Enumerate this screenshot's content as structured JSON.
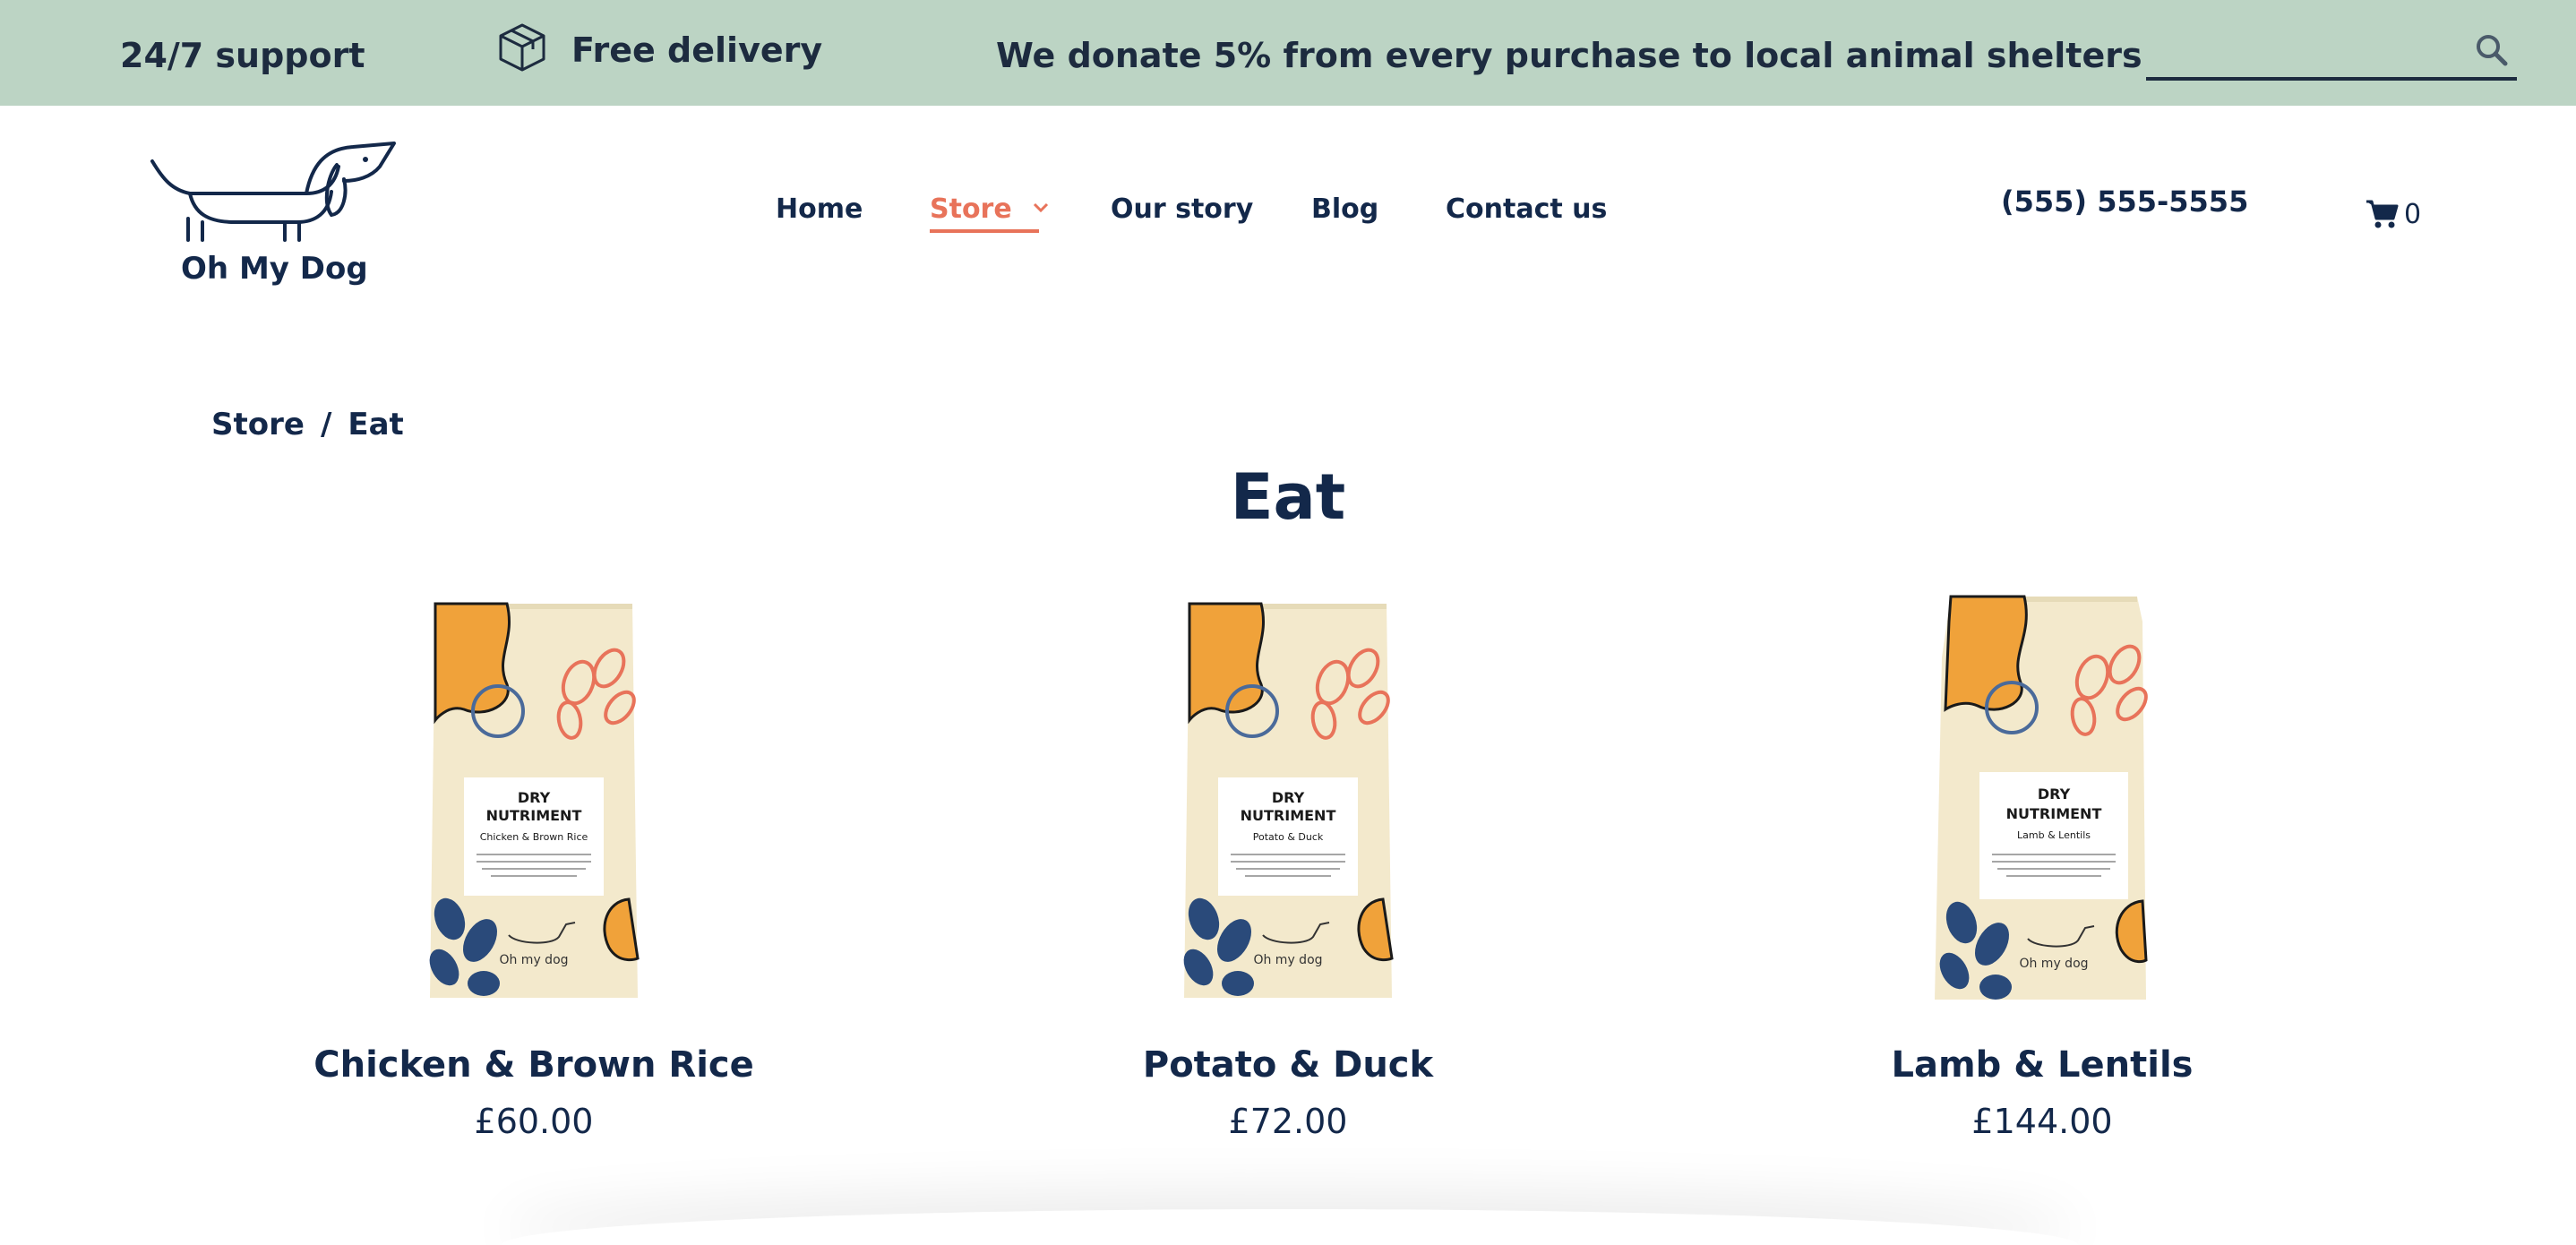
{
  "topbar": {
    "support": "24/7 support",
    "delivery": "Free delivery",
    "donate": "We donate 5% from every purchase to local animal shelters",
    "search_placeholder": "",
    "icons": {
      "delivery": "package-box-icon",
      "search": "search-icon"
    }
  },
  "header": {
    "logo_text": "Oh My Dog",
    "nav": [
      {
        "label": "Home",
        "active": false
      },
      {
        "label": "Store",
        "active": true,
        "has_dropdown": true
      },
      {
        "label": "Our story",
        "active": false
      },
      {
        "label": "Blog",
        "active": false
      },
      {
        "label": "Contact us",
        "active": false
      }
    ],
    "phone": "(555) 555-5555",
    "cart_count": "0",
    "icons": {
      "cart": "shopping-cart-icon",
      "dropdown": "chevron-down-icon"
    }
  },
  "breadcrumb": {
    "parent": "Store",
    "separator": "/",
    "current": "Eat"
  },
  "page_title": "Eat",
  "products": [
    {
      "name": "Chicken & Brown Rice",
      "price": "£60.00",
      "bag": {
        "title_1": "DRY",
        "title_2": "NUTRIMENT",
        "flavor": "Chicken & Brown Rice",
        "brand": "Oh my dog"
      }
    },
    {
      "name": "Potato & Duck",
      "price": "£72.00",
      "bag": {
        "title_1": "DRY",
        "title_2": "NUTRIMENT",
        "flavor": "Potato & Duck",
        "brand": "Oh my dog"
      }
    },
    {
      "name": "Lamb & Lentils",
      "price": "£144.00",
      "bag": {
        "title_1": "DRY",
        "title_2": "NUTRIMENT",
        "flavor": "Lamb & Lentils",
        "brand": "Oh my dog"
      }
    }
  ],
  "colors": {
    "topbar_bg": "#bcd4c4",
    "text_dark": "#13284a",
    "accent": "#e8735a",
    "bag_cream": "#f3e9cc",
    "bag_orange": "#f0a23a",
    "bag_blue": "#2a4a7a",
    "bag_red_line": "#e8735a"
  }
}
